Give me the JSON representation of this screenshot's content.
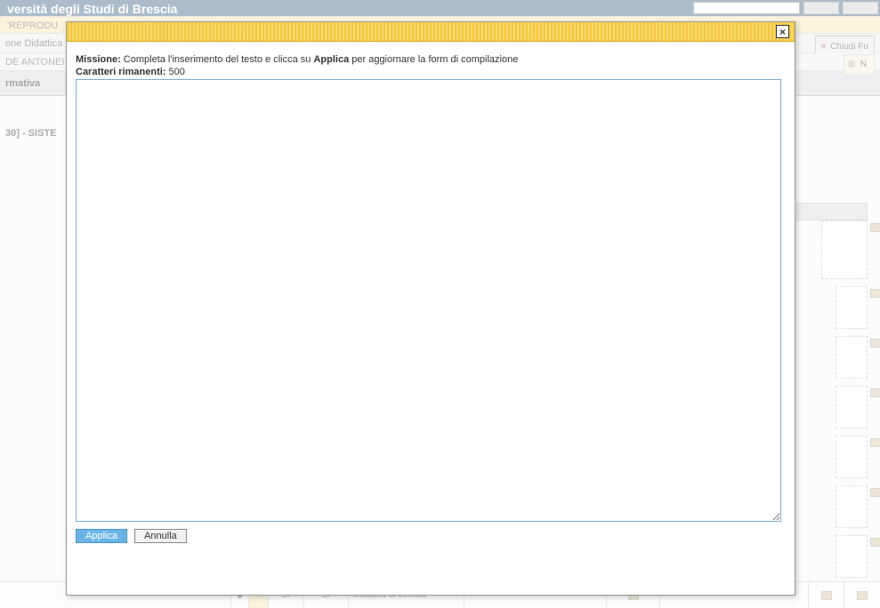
{
  "bg": {
    "header_title": "versità degli Studi di Brescia",
    "row1": "'REPRODU",
    "row2_left": "one Didattica",
    "row3_left": "DE ANTONEI",
    "row4": "rmativa",
    "section": "30] - SISTE",
    "chiudi": "Chiudi Fu",
    "n_label": "N",
    "bottom": {
      "si1": "Sì",
      "si2": "Sì",
      "verifica": "Modalità di verifica"
    }
  },
  "modal": {
    "label": "Missione:",
    "instruction_pre": "Completa l'inserimento del testo e clicca su",
    "instruction_bold": "Applica",
    "instruction_post": "per aggiornare la form di compilazione",
    "chars_label": "Caratteri rimanenti:",
    "chars_value": "500",
    "textarea_value": "",
    "apply": "Applica",
    "cancel": "Annulla",
    "close_glyph": "×"
  }
}
